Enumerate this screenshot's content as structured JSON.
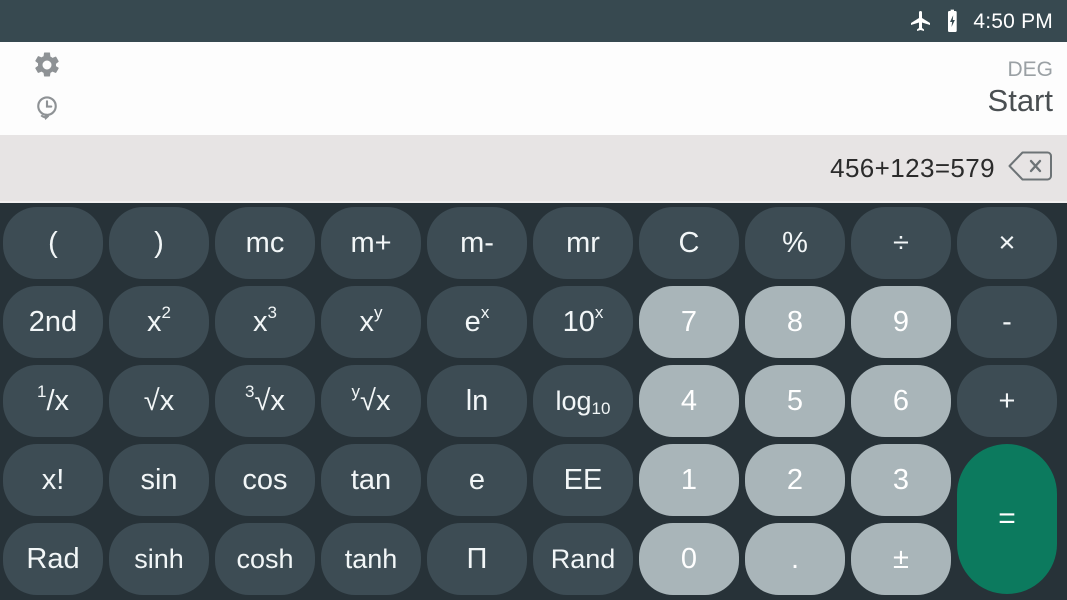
{
  "status_bar": {
    "time": "4:50 PM",
    "icons": [
      "airplane-mode-icon",
      "battery-charging-icon"
    ]
  },
  "header": {
    "settings_icon": "gear-icon",
    "history_icon": "history-clock-icon",
    "angle_mode": "DEG",
    "start_label": "Start"
  },
  "expression": {
    "text": "456+123=579",
    "clear_icon": "backspace-icon"
  },
  "keypad": {
    "rows": [
      [
        {
          "label": "(",
          "style": "dark"
        },
        {
          "label": ")",
          "style": "dark"
        },
        {
          "label": "mc",
          "style": "dark"
        },
        {
          "label": "m+",
          "style": "dark"
        },
        {
          "label": "m-",
          "style": "dark"
        },
        {
          "label": "mr",
          "style": "dark"
        },
        {
          "label": "C",
          "style": "dark"
        },
        {
          "label": "%",
          "style": "dark"
        },
        {
          "label": "÷",
          "style": "dark"
        },
        {
          "label": "×",
          "style": "dark"
        }
      ],
      [
        {
          "label": "2nd",
          "style": "dark"
        },
        {
          "label": "x²",
          "style": "dark"
        },
        {
          "label": "x³",
          "style": "dark"
        },
        {
          "label": "xʸ",
          "style": "dark"
        },
        {
          "label": "eˣ",
          "style": "dark"
        },
        {
          "label": "10ˣ",
          "style": "dark"
        },
        {
          "label": "7",
          "style": "light"
        },
        {
          "label": "8",
          "style": "light"
        },
        {
          "label": "9",
          "style": "light"
        },
        {
          "label": "-",
          "style": "dark"
        }
      ],
      [
        {
          "label": "¹/x",
          "style": "dark"
        },
        {
          "label": "√x",
          "style": "dark"
        },
        {
          "label": "³√x",
          "style": "dark"
        },
        {
          "label": "ʸ√x",
          "style": "dark"
        },
        {
          "label": "ln",
          "style": "dark"
        },
        {
          "label": "log₁₀",
          "style": "dark"
        },
        {
          "label": "4",
          "style": "light"
        },
        {
          "label": "5",
          "style": "light"
        },
        {
          "label": "6",
          "style": "light"
        },
        {
          "label": "+",
          "style": "dark"
        }
      ],
      [
        {
          "label": "x!",
          "style": "dark"
        },
        {
          "label": "sin",
          "style": "dark"
        },
        {
          "label": "cos",
          "style": "dark"
        },
        {
          "label": "tan",
          "style": "dark"
        },
        {
          "label": "e",
          "style": "dark"
        },
        {
          "label": "EE",
          "style": "dark"
        },
        {
          "label": "1",
          "style": "light"
        },
        {
          "label": "2",
          "style": "light"
        },
        {
          "label": "3",
          "style": "light"
        },
        {
          "label": "=",
          "style": "equals"
        }
      ],
      [
        {
          "label": "Rad",
          "style": "dark"
        },
        {
          "label": "sinh",
          "style": "dark"
        },
        {
          "label": "cosh",
          "style": "dark"
        },
        {
          "label": "tanh",
          "style": "dark"
        },
        {
          "label": "Π",
          "style": "dark"
        },
        {
          "label": "Rand",
          "style": "dark"
        },
        {
          "label": "0",
          "style": "light"
        },
        {
          "label": ".",
          "style": "light"
        },
        {
          "label": "±",
          "style": "light"
        }
      ]
    ]
  },
  "colors": {
    "status_bar": "#374950",
    "header": "#fdfdfd",
    "expression_bar": "#e7e4e4",
    "keypad_bg": "#273238",
    "key_dark": "#3d4c54",
    "key_light": "#a9b5b9",
    "key_equals": "#0c7a5e"
  }
}
